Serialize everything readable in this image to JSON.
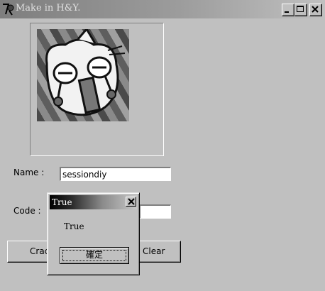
{
  "window": {
    "title": "Make in H&Y.",
    "controls": [
      "minimize-icon",
      "maximize-icon",
      "close-icon"
    ]
  },
  "form": {
    "name_label": "Name :",
    "name_value": "sessiondiy",
    "code_label": "Code :",
    "code_value": "",
    "crack_label": "Crack",
    "clear_label": "Clear"
  },
  "dialog": {
    "title": "True",
    "message": "True",
    "ok_label": "確定"
  },
  "colors": {
    "face": "#c0c0c0",
    "field": "#ffffff"
  }
}
